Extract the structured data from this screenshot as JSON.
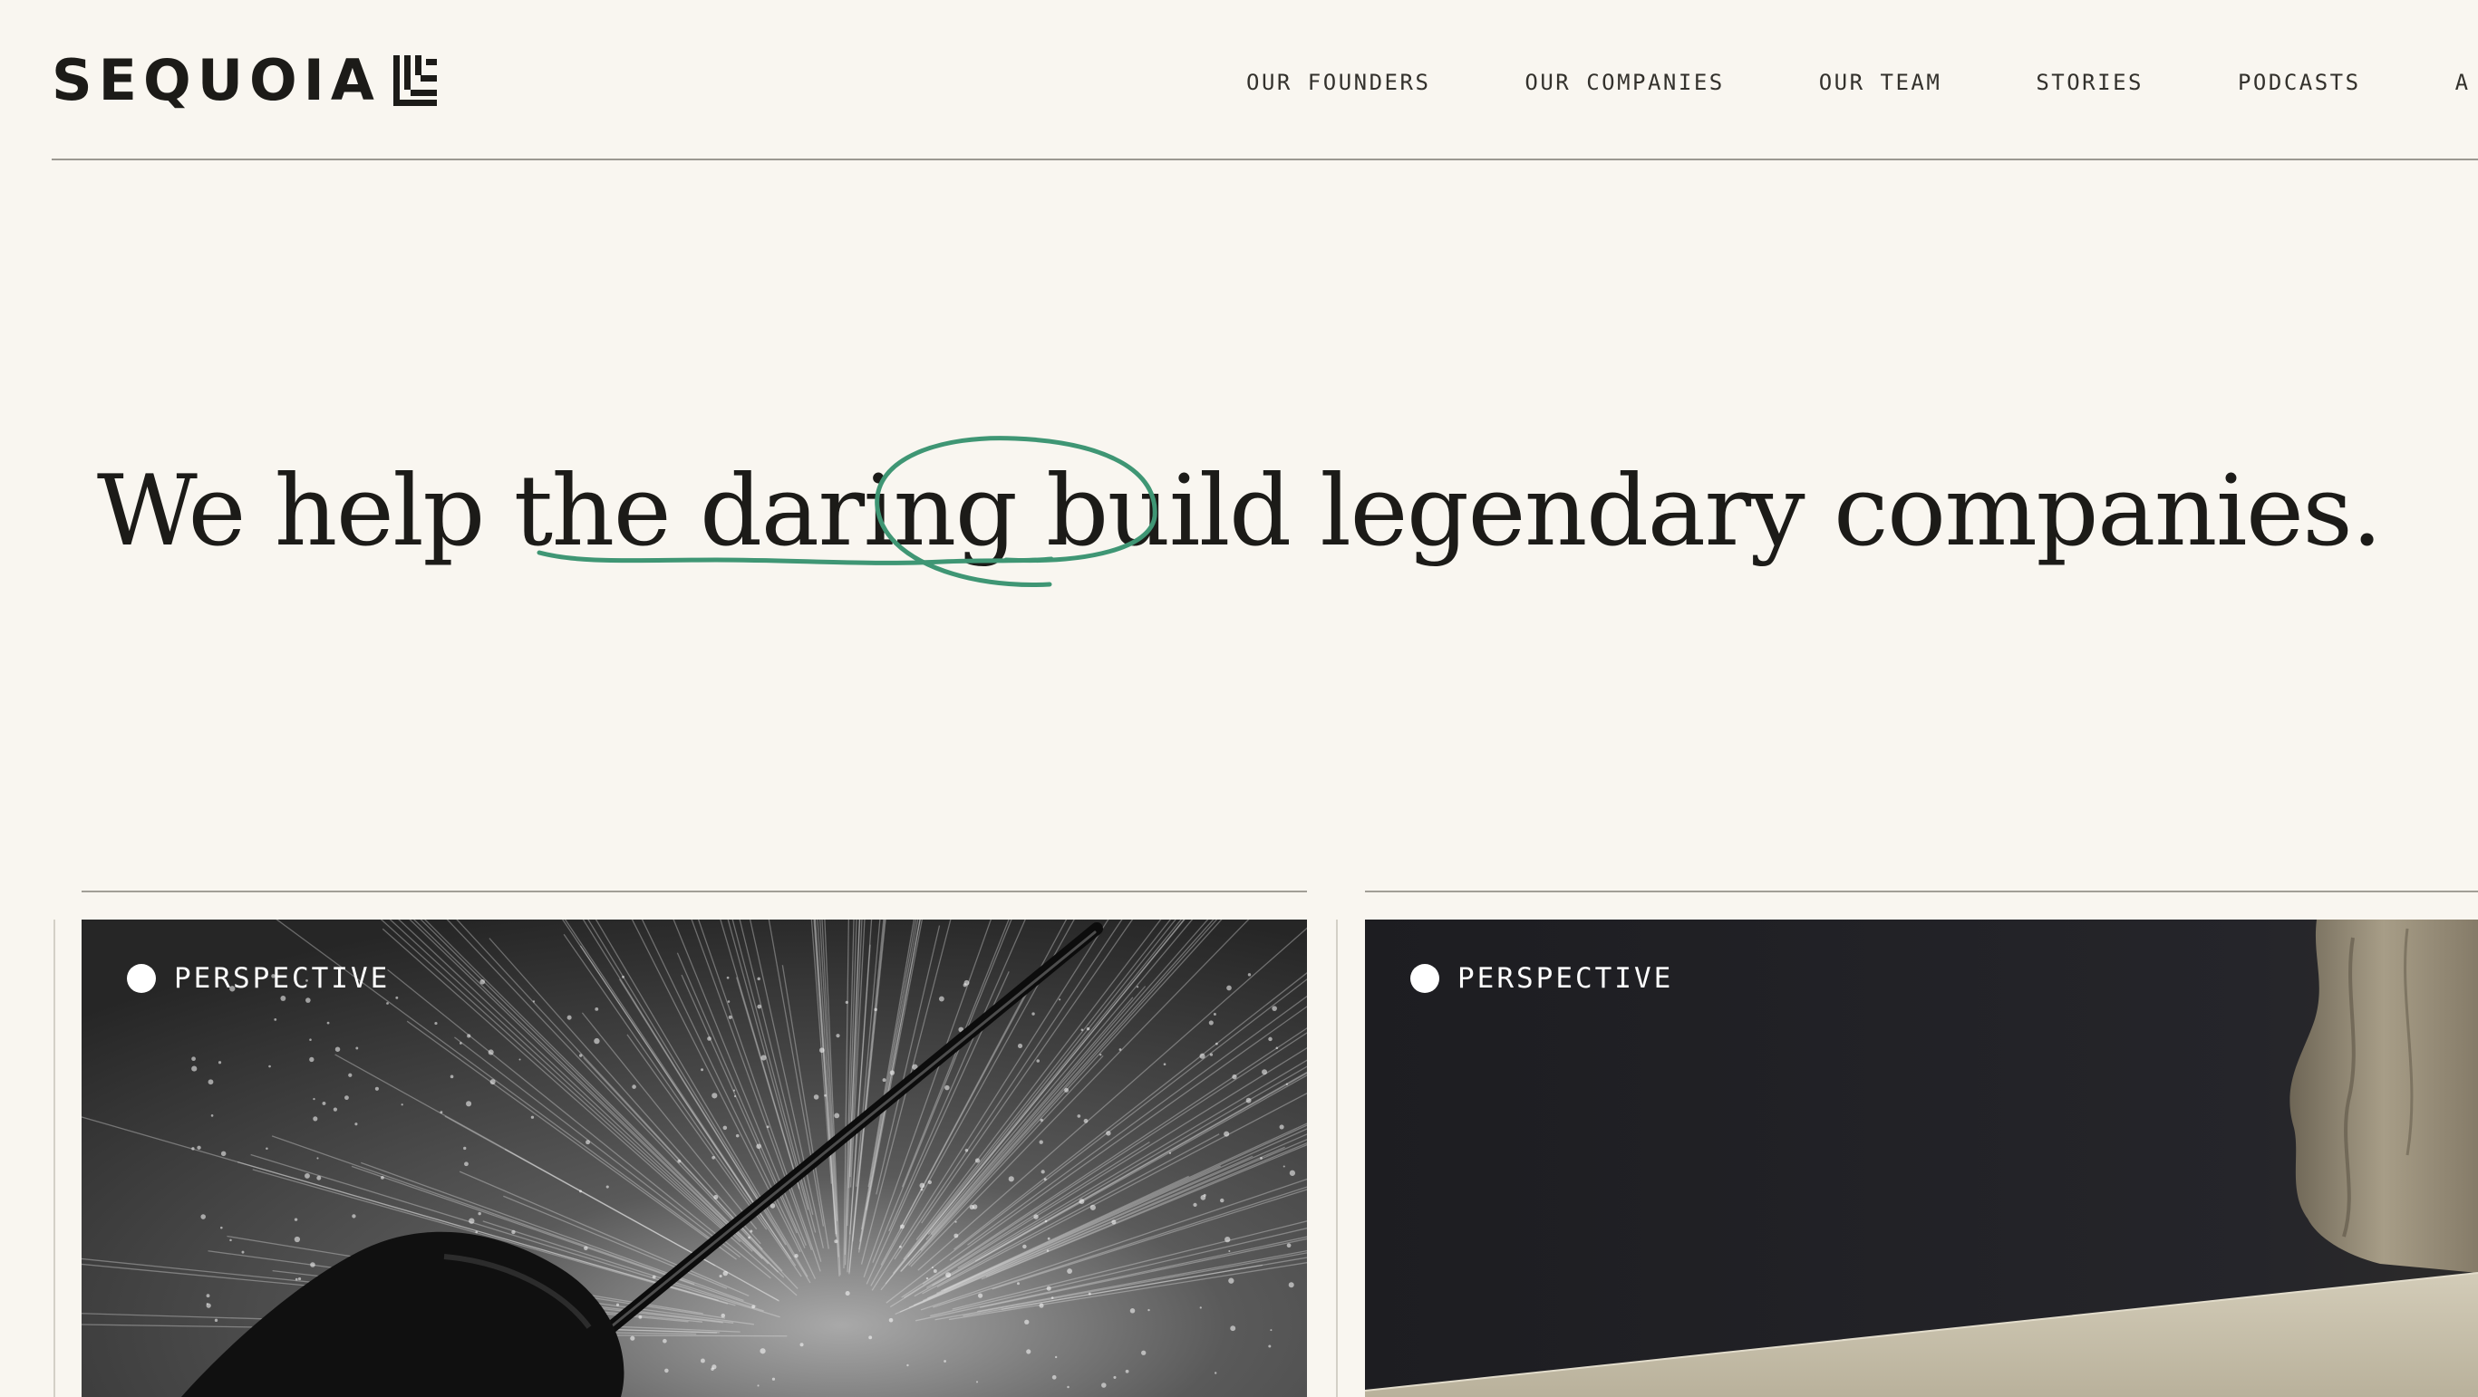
{
  "header": {
    "logo_text": "SEQUOIA",
    "nav": [
      {
        "label": "OUR FOUNDERS"
      },
      {
        "label": "OUR COMPANIES"
      },
      {
        "label": "OUR TEAM"
      },
      {
        "label": "STORIES"
      },
      {
        "label": "PODCASTS"
      },
      {
        "label": "A"
      }
    ]
  },
  "hero": {
    "part1": "We ",
    "underlined": "help the ",
    "circled": "daring",
    "part2": " build legendary companies.",
    "accent_color": "#3f9674"
  },
  "cards": [
    {
      "tag": "PERSPECTIVE"
    },
    {
      "tag": "PERSPECTIVE"
    }
  ],
  "colors": {
    "background": "#f9f6f0",
    "text": "#1c1b18",
    "rule": "#9b9891"
  }
}
